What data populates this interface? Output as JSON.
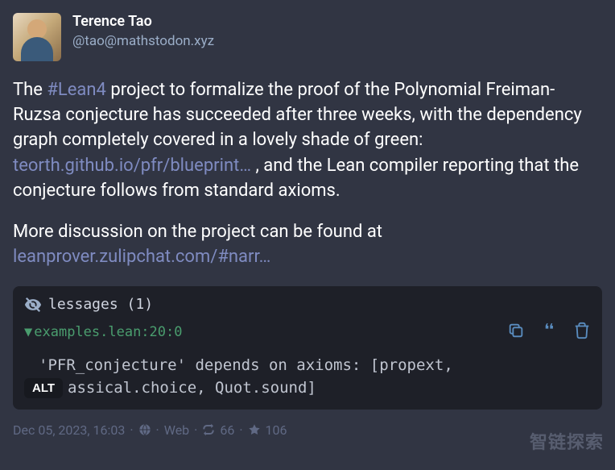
{
  "user": {
    "display_name": "Terence Tao",
    "handle": "@tao@mathstodon.xyz"
  },
  "post": {
    "text1_prefix": "The ",
    "hashtag": "#Lean4",
    "text1_mid": " project to formalize the proof of the Polynomial Freiman-Ruzsa conjecture has succeeded after three weeks, with the dependency graph completely covered in a lovely shade of green: ",
    "link1": "teorth.github.io/pfr/blueprint…",
    "text1_suffix": " , and the Lean compiler reporting that the conjecture follows from standard axioms.",
    "text2": "More discussion on the project can be found at ",
    "link2": "leanprover.zulipchat.com/#narr…"
  },
  "code": {
    "header_title": "lessages (1)",
    "file_path": "examples.lean:20:0",
    "line1": "'PFR_conjecture' depends on axioms: [propext,",
    "line2_visible": "assical.choice, Quot.sound]",
    "alt_badge": "ALT"
  },
  "meta": {
    "timestamp": "Dec 05, 2023, 16:03",
    "client": "Web",
    "boosts": "66",
    "favorites": "106"
  },
  "watermark": "智链探索"
}
